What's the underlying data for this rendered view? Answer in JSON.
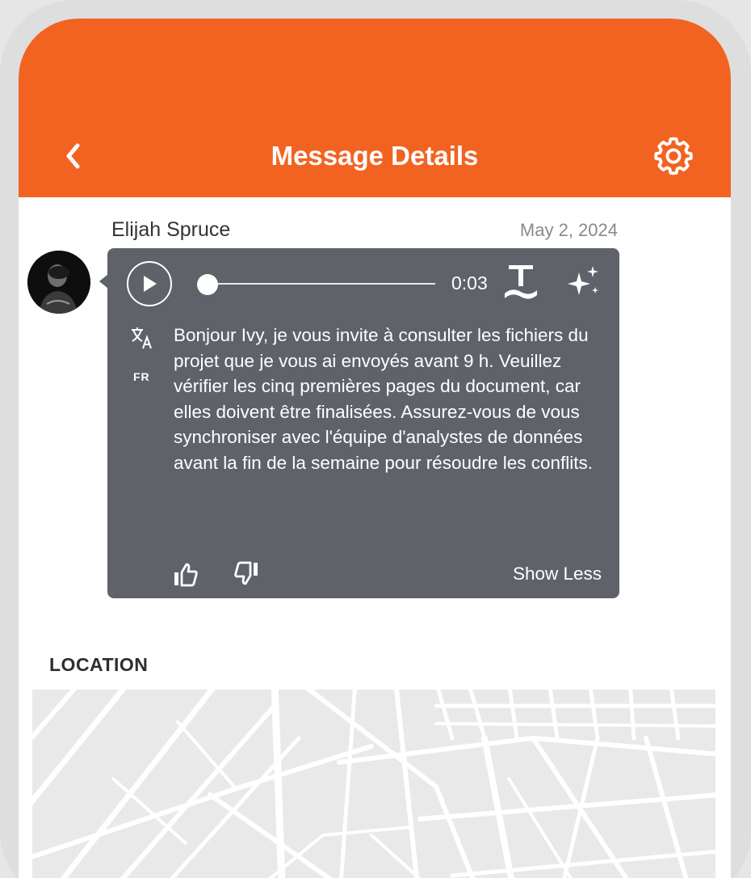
{
  "header": {
    "title": "Message Details",
    "back_icon": "chevron-left-icon",
    "settings_icon": "gear-icon",
    "background_color": "#f26322"
  },
  "message": {
    "sender": "Elijah Spruce",
    "date": "May 2, 2024",
    "audio": {
      "duration": "0:03",
      "progress": 0
    },
    "language": "FR",
    "text": "Bonjour Ivy, je vous invite à consulter les fichiers du projet que je vous ai envoyés avant 9 h. Veuillez vérifier les cinq premières pages du document, car elles doivent être finalisées. Assurez-vous de vous synchroniser avec l'équipe d'analystes de données avant la fin de la semaine pour résoudre les conflits.",
    "show_less_label": "Show Less",
    "bubble_color": "#5f6369"
  },
  "location": {
    "label": "LOCATION"
  }
}
